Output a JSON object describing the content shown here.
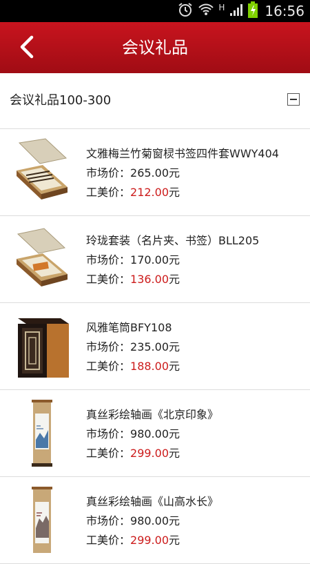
{
  "status_bar": {
    "time": "16:56",
    "network": "H",
    "icons": [
      "alarm-icon",
      "wifi-icon",
      "signal-icon",
      "battery-icon"
    ]
  },
  "header": {
    "title": "会议礼品",
    "back_icon": "chevron-left-icon"
  },
  "section": {
    "title": "会议礼品100-300",
    "toggle_icon": "minus-box-icon"
  },
  "labels": {
    "market_price": "市场价：",
    "member_price": "工美价：",
    "currency": "元"
  },
  "colors": {
    "header_red": "#b50f18",
    "price_red": "#cc1b1b"
  },
  "products": [
    {
      "name": "文雅梅兰竹菊窗棂书签四件套WWY404",
      "market_price": "265.00",
      "price": "212.00",
      "image": "gift-box-image"
    },
    {
      "name": "玲珑套装（名片夹、书签）BLL205",
      "market_price": "170.00",
      "price": "136.00",
      "image": "gift-box-image"
    },
    {
      "name": "风雅笔筒BFY108",
      "market_price": "235.00",
      "price": "188.00",
      "image": "pen-holder-image"
    },
    {
      "name": "真丝彩绘轴画《北京印象》",
      "market_price": "980.00",
      "price": "299.00",
      "image": "scroll-painting-image"
    },
    {
      "name": "真丝彩绘轴画《山高水长》",
      "market_price": "980.00",
      "price": "299.00",
      "image": "scroll-painting-image"
    }
  ]
}
